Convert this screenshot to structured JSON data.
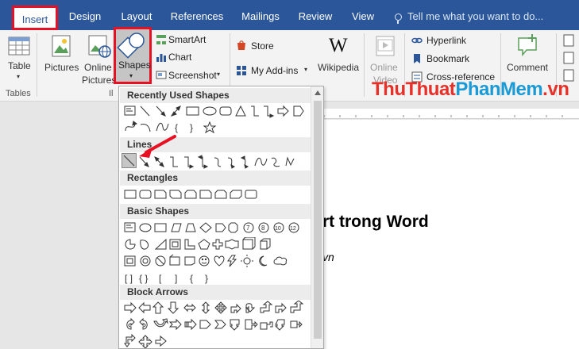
{
  "tabs": [
    {
      "label": "Insert",
      "active": true
    },
    {
      "label": "Design"
    },
    {
      "label": "Layout"
    },
    {
      "label": "References"
    },
    {
      "label": "Mailings"
    },
    {
      "label": "Review"
    },
    {
      "label": "View"
    }
  ],
  "tellme_placeholder": "Tell me what you want to do...",
  "ribbon": {
    "table_label": "Table",
    "tables_group": "Tables",
    "pictures_label": "Pictures",
    "online_pictures_label1": "Online",
    "online_pictures_label2": "Pictures",
    "illustrations_group_partial": "Il",
    "shapes_label": "Shapes",
    "smartart_label": "SmartArt",
    "chart_label": "Chart",
    "screenshot_label": "Screenshot",
    "store_label": "Store",
    "myaddins_label": "My Add-ins",
    "wikipedia_label": "Wikipedia",
    "online_video_label1": "Online",
    "online_video_label2": "Video",
    "hyperlink_label": "Hyperlink",
    "bookmark_label": "Bookmark",
    "crossref_label": "Cross-reference",
    "comment_label": "Comment"
  },
  "watermark": {
    "part1": "ThuThuat",
    "part2": "PhanMem",
    "part3": ".vn"
  },
  "document": {
    "heading": "rt trong Word",
    "subline": "vn"
  },
  "shapes_panel": {
    "sections": [
      "Recently Used Shapes",
      "Lines",
      "Rectangles",
      "Basic Shapes",
      "Block Arrows"
    ]
  },
  "colors": {
    "accent": "#2b579a",
    "highlight": "#e81123"
  }
}
